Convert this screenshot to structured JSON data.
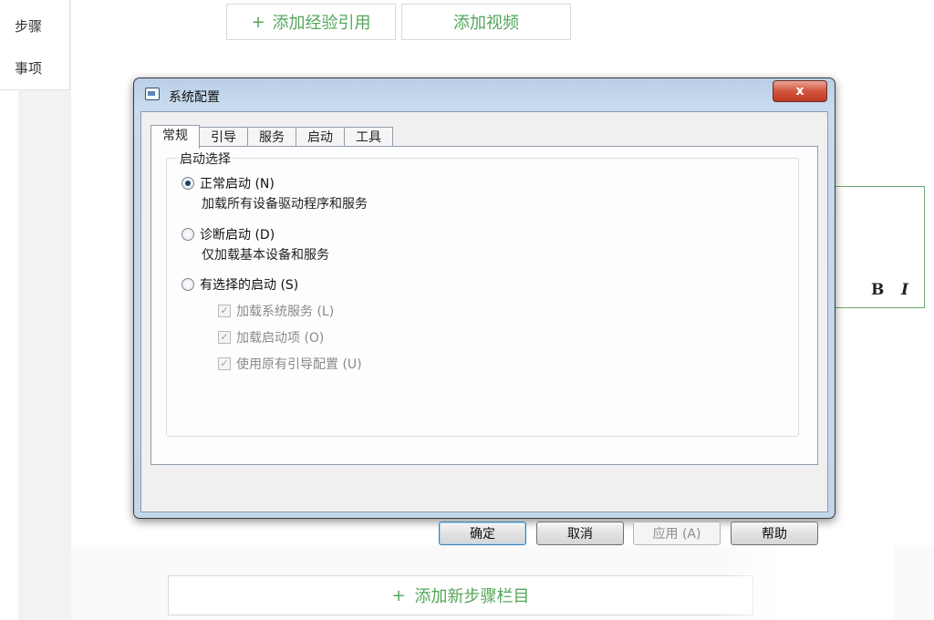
{
  "background": {
    "sidebar": {
      "item_steps": "步骤",
      "item_notes": "事项"
    },
    "top_buttons": {
      "add_reference": "添加经验引用",
      "add_video": "添加视频"
    },
    "format_toolbar": {
      "bold": "B",
      "italic": "I"
    },
    "bottom_button": {
      "label": "添加新步骤栏目"
    },
    "plus_glyph": "+"
  },
  "dialog": {
    "title": "系统配置",
    "close_glyph": "x",
    "tabs": [
      {
        "label": "常规"
      },
      {
        "label": "引导"
      },
      {
        "label": "服务"
      },
      {
        "label": "启动"
      },
      {
        "label": "工具"
      }
    ],
    "group_label": "启动选择",
    "options": [
      {
        "label": "正常启动 (N)",
        "desc": "加载所有设备驱动程序和服务",
        "checked": true
      },
      {
        "label": "诊断启动 (D)",
        "desc": "仅加载基本设备和服务",
        "checked": false
      },
      {
        "label": "有选择的启动 (S)",
        "desc": "",
        "checked": false
      }
    ],
    "sub_options": [
      {
        "label": "加载系统服务 (L)",
        "checked": true
      },
      {
        "label": "加载启动项 (O)",
        "checked": true
      },
      {
        "label": "使用原有引导配置 (U)",
        "checked": true
      }
    ],
    "check_glyph": "✓",
    "buttons": {
      "ok": "确定",
      "cancel": "取消",
      "apply": "应用 (A)",
      "help": "帮助"
    }
  }
}
